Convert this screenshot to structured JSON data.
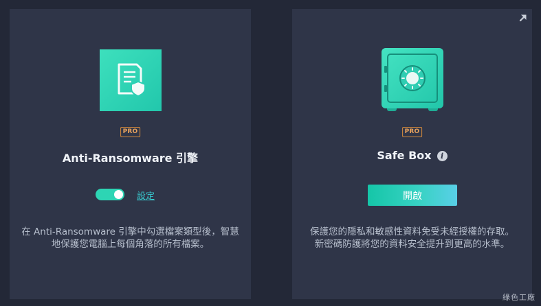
{
  "anti_ransomware": {
    "icon": "shield-document-icon",
    "badge": "PRO",
    "title": "Anti-Ransomware 引擎",
    "toggle_on": true,
    "settings_label": "設定",
    "description_line1": "在 Anti-Ransomware 引擎中勾選檔案類型後，智慧",
    "description_line2": "地保護您電腦上每個角落的所有檔案。"
  },
  "safe_box": {
    "icon": "safe-icon",
    "badge": "PRO",
    "title": "Safe Box",
    "open_label": "開啟",
    "description_line1": "保護您的隱私和敏感性資料免受未經授權的存取。",
    "description_line2": "新密碼防護將您的資料安全提升到更高的水準。"
  },
  "watermark": "綠色工廠",
  "colors": {
    "background": "#232837",
    "card": "#2f3548",
    "accent": "#2dd5b4",
    "pro_badge": "#e9a35e"
  }
}
